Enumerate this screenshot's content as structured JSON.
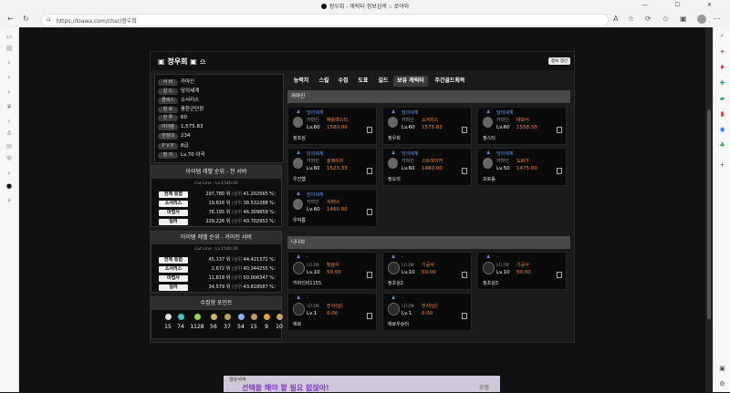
{
  "browser": {
    "tab_title": "정우희 - 캐릭터 정보검색 :: 로아와",
    "url": "https://loawa.com/char/정우희",
    "window_controls": "— ☐ ✕"
  },
  "character": {
    "name": "정우희",
    "renew_label": "정보 갱신",
    "info": [
      {
        "label": "서 버",
        "value": "카마인"
      },
      {
        "label": "길 드",
        "value": "당의세계"
      },
      {
        "label": "클래스",
        "value": "소서리스"
      },
      {
        "label": "칭 호",
        "value": "풍환군단장"
      },
      {
        "label": "전 투",
        "value": "60"
      },
      {
        "label": "아이템",
        "value": "1,575.83"
      },
      {
        "label": "원정대",
        "value": "234"
      },
      {
        "label": "P V P",
        "value": "8급"
      },
      {
        "label": "영 지",
        "value": "Lv.70 이곡"
      }
    ]
  },
  "rank_all": {
    "title": "아이템 레벨 순위 - 전 서버",
    "cutline": "Cut Line : Lv.1540.00",
    "rows": [
      {
        "label": "전체 통합",
        "rank": "297,780 위",
        "pct": "41.202565 %"
      },
      {
        "label": "소서리스",
        "rank": "19,816 위",
        "pct": "38.532288 %"
      },
      {
        "label": "마법사",
        "rank": "76,195 위",
        "pct": "46.309859 %"
      },
      {
        "label": "딜러",
        "rank": "229,226 위",
        "pct": "40.702952 %"
      }
    ]
  },
  "rank_server": {
    "title": "아이템 레벨 순위 - 카마인 서버",
    "cutline": "Cut Line : Lv.1540.00",
    "rows": [
      {
        "label": "전체 통합",
        "rank": "45,137 위",
        "pct": "44.421372 %"
      },
      {
        "label": "소서리스",
        "rank": "2,672 위",
        "pct": "40.344255 %"
      },
      {
        "label": "마법사",
        "rank": "11,818 위",
        "pct": "50.006347 %"
      },
      {
        "label": "딜러",
        "rank": "34,579 위",
        "pct": "43.818587 %"
      }
    ]
  },
  "rank_prefix": "(상위",
  "rank_suffix": ")",
  "collect": {
    "title": "수집형 포인트",
    "items": [
      {
        "icon": "island-heart-icon",
        "value": "15",
        "color": "#e0e0e0"
      },
      {
        "icon": "orpheus-star-icon",
        "value": "74",
        "color": "#3fc4c4"
      },
      {
        "icon": "mokoko-seed-icon",
        "value": "1128",
        "color": "#9bd64b"
      },
      {
        "icon": "art-icon",
        "value": "56",
        "color": "#d9b36a"
      },
      {
        "icon": "voyage-icon",
        "value": "37",
        "color": "#b7a35a"
      },
      {
        "icon": "cosmic-star-icon",
        "value": "54",
        "color": "#8ab0ff"
      },
      {
        "icon": "world-tree-leaf-icon",
        "value": "15",
        "color": "#c49a5c"
      },
      {
        "icon": "ignea-token-icon",
        "value": "9",
        "color": "#e0a040"
      },
      {
        "icon": "giant-heart-icon",
        "value": "10",
        "color": "#c8a070"
      }
    ]
  },
  "tabs": [
    "능력치",
    "스킬",
    "수집",
    "도표",
    "길드",
    "보유 캐릭터",
    "주간골드획득"
  ],
  "active_tab": "보유 캐릭터",
  "sections": {
    "kamine": "카마인",
    "nineave": "니나브"
  },
  "kamine_chars": [
    {
      "server": "당의세계",
      "cls": "카마인",
      "cname": "배틀마스터",
      "lv": "Lv.60",
      "ilvl": "1580.00",
      "name": "정초심"
    },
    {
      "server": "당의세계",
      "cls": "카마인",
      "cname": "소서리스",
      "lv": "Lv.60",
      "ilvl": "1575.83",
      "name": "정우희"
    },
    {
      "server": "당의세계",
      "cls": "카마인",
      "cname": "데모닉",
      "lv": "Lv.60",
      "ilvl": "1558.33",
      "name": "정스티"
    },
    {
      "server": "당의세계",
      "cls": "카마인",
      "cname": "슬레이어",
      "lv": "Lv.60",
      "ilvl": "1523.33",
      "name": "우진햄"
    },
    {
      "server": "당의세계",
      "cls": "카마인",
      "cname": "스트라이커",
      "lv": "Lv.60",
      "ilvl": "1480.00",
      "name": "정오의"
    },
    {
      "server": "당의세계",
      "cls": "카마인",
      "cname": "도화가",
      "lv": "Lv.50",
      "ilvl": "1475.00",
      "name": "프로음"
    },
    {
      "server": "당의세계",
      "cls": "카마인",
      "cname": "서머너",
      "lv": "Lv.60",
      "ilvl": "1460.00",
      "name": "우여름"
    }
  ],
  "nineave_chars": [
    {
      "server": "-",
      "cls": "니나브",
      "cname": "창술사",
      "lv": "Lv.10",
      "ilvl": "50.00",
      "name": "카마인비1155"
    },
    {
      "server": "-",
      "cls": "니나브",
      "cname": "기공사",
      "lv": "Lv.10",
      "ilvl": "50.00",
      "name": "정초심2"
    },
    {
      "server": "-",
      "cls": "니나브",
      "cname": "기공사",
      "lv": "Lv.10",
      "ilvl": "50.00",
      "name": "정초심3"
    },
    {
      "server": "-",
      "cls": "니나브",
      "cname": "전사(남)",
      "lv": "Lv.1",
      "ilvl": "0.00",
      "name": "애로"
    },
    {
      "server": "-",
      "cls": "니나브",
      "cname": "전사(남)",
      "lv": "Lv.1",
      "ilvl": "0.00",
      "name": "애로우슈터"
    }
  ],
  "ad": {
    "line1": "경유석역",
    "line2": "선택을 해야 할 필요 없잖아!",
    "line3": "모험"
  }
}
